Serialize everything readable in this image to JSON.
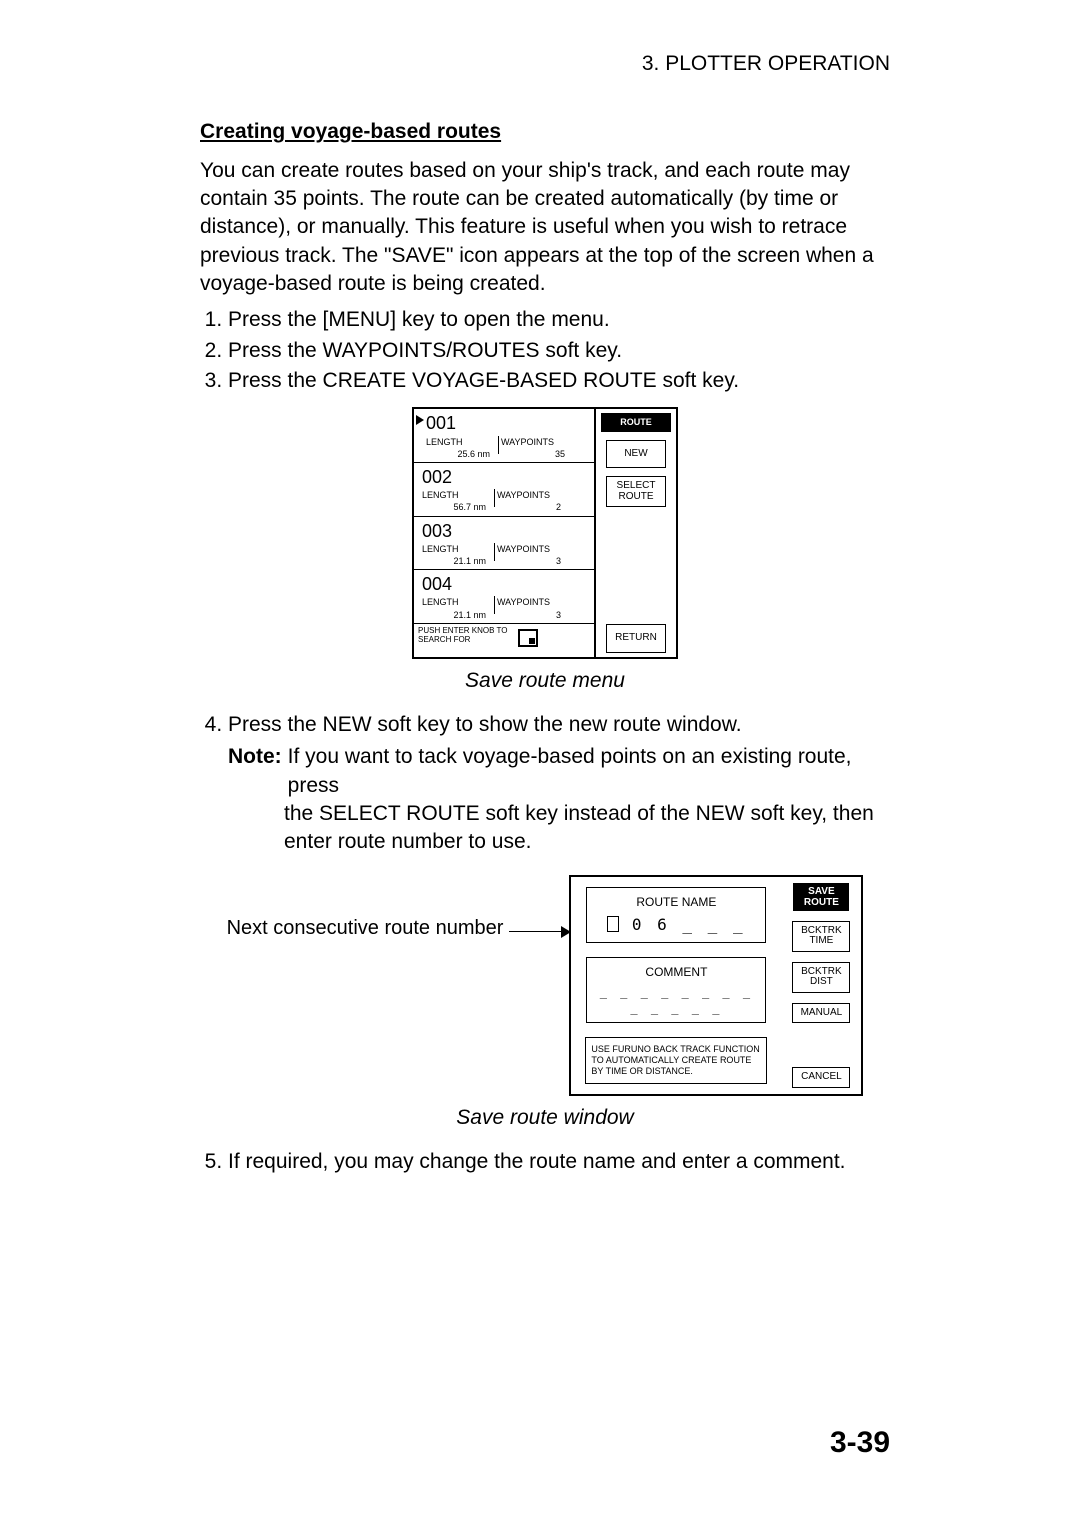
{
  "header": {
    "chapter": "3. PLOTTER OPERATION"
  },
  "subheading": "Creating voyage-based routes",
  "intro_para": "You can create routes based on your ship's track, and each route may contain 35 points. The route can be created automatically (by time or distance), or manually. This feature is useful when you wish to retrace previous track. The \"SAVE\" icon appears at the top of the screen when a voyage-based route is being created.",
  "steps_a": {
    "s1": "Press the [MENU] key to open the menu.",
    "s2": "Press the WAYPOINTS/ROUTES soft key.",
    "s3": "Press the CREATE VOYAGE-BASED ROUTE soft key."
  },
  "diagram1": {
    "routes": [
      {
        "id": "001",
        "len_lbl": "LENGTH",
        "len": "25.6 nm",
        "wp_lbl": "WAYPOINTS",
        "wp": "35",
        "sel": true
      },
      {
        "id": "002",
        "len_lbl": "LENGTH",
        "len": "56.7 nm",
        "wp_lbl": "WAYPOINTS",
        "wp": "2",
        "sel": false
      },
      {
        "id": "003",
        "len_lbl": "LENGTH",
        "len": "21.1 nm",
        "wp_lbl": "WAYPOINTS",
        "wp": "3",
        "sel": false
      },
      {
        "id": "004",
        "len_lbl": "LENGTH",
        "len": "21.1 nm",
        "wp_lbl": "WAYPOINTS",
        "wp": "3",
        "sel": false
      }
    ],
    "search_line1": "PUSH ENTER KNOB TO",
    "search_line2": "SEARCH FOR",
    "right_title": "ROUTE",
    "btn_new": "NEW",
    "btn_select1": "SELECT",
    "btn_select2": "ROUTE",
    "btn_return": "RETURN"
  },
  "caption1": "Save route menu",
  "step4": "Press the NEW soft key to show the new route window.",
  "note_lbl": "Note:",
  "note_body_l1": "If you want to tack voyage-based points on an existing route, press",
  "note_body_l2": "the SELECT ROUTE soft key instead of the NEW soft key, then enter route number to use.",
  "d2_side_label": "Next consecutive route number",
  "diagram2": {
    "route_name_lbl": "ROUTE NAME",
    "route_name_val": "0 6 _ _ _",
    "comment_lbl": "COMMENT",
    "comment_val": "_ _ _ _ _ _ _ _ _ _ _ _ _",
    "info_l1": "USE FURUNO BACK TRACK FUNCTION",
    "info_l2": "TO AUTOMATICALLY CREATE ROUTE",
    "info_l3": "BY TIME OR DISTANCE.",
    "right_t1": "SAVE",
    "right_t2": "ROUTE",
    "btn_bt1a": "BCKTRK",
    "btn_bt1b": "TIME",
    "btn_bt2a": "BCKTRK",
    "btn_bt2b": "DIST",
    "btn_manual": "MANUAL",
    "btn_cancel": "CANCEL"
  },
  "caption2": "Save route window",
  "step5": "If required, you may change the route name and enter a comment.",
  "page_no": "3-39"
}
